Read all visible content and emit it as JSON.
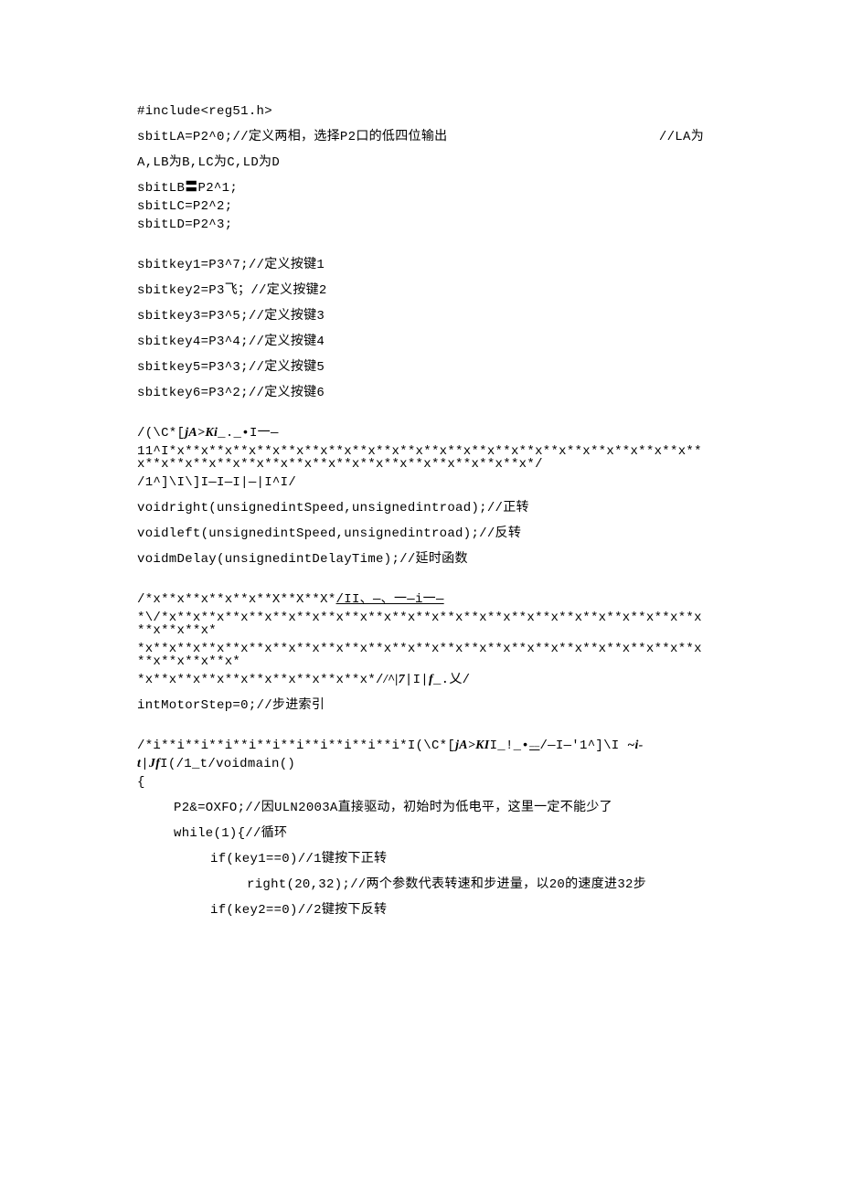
{
  "lines": {
    "l1": "#include<reg51.h>",
    "l2a": "sbitLA=P2^0;//定义两相，选择P2口的低四位输出",
    "l2b": "//LA为",
    "l3": "A,LB为B,LC为C,LD为D",
    "l4": "sbitLB〓P2^1;",
    "l5": "sbitLC=P2^2;",
    "l6": "sbitLD=P2^3;",
    "l7": "sbitkey1=P3^7;//定义按键1",
    "l8": "sbitkey2=P3飞；//定义按键2",
    "l9": "sbitkey3=P3^5;//定义按键3",
    "l10": "sbitkey4=P3^4;//定义按键4",
    "l11": "sbitkey5=P3^3;//定义按键5",
    "l12": "sbitkey6=P3^2;//定义按键6",
    "l13a": "/(\\C*[",
    "l13b": "jA>Ki",
    "l13c": "_._•I一—",
    "l14": "11^I*x**x**x**x**x**x**x**x**x**x**x**x**x**x**x**x**x**x**x**x**x**x**x**x**x**x**x**x**x**x**x**x**x**x**x**x**x**x**x*/",
    "l15": "/1^]\\I\\]I—I—I|—|I^I/",
    "l16": "voidright(unsignedintSpeed,unsignedintroad);//正转",
    "l17": "voidleft(unsignedintSpeed,unsignedintroad);//反转",
    "l18": "voidmDelay(unsignedintDelayTime);//延时函数",
    "l19a": "/*x**x**x**x**x**X**X**X*",
    "l19b": "/II、—、一—i一—",
    "l20": "*\\/*x**x**x**x**x**x**x**x**x**x**x**x**x**x**x**x**x**x**x**x**x**x**x**x**x**x*",
    "l21": "*x**x**x**x**x**x**x**x**x**x**x**x**x**x**x**x**x**x**x**x**x**x**x**x**x**x**x**x*",
    "l22a": "*x**x**x**x**x**x**x**x**x**x*/",
    "l22b": "/^|7",
    "l22c": "|I|",
    "l22d": "f",
    "l22e": "_.乂/",
    "l23": "intMotorStep=0;//步进索引",
    "l24a": "/*i**i**i**i**i**i**i**i**i**i**i*I(\\C*[",
    "l24b": "jA>KI",
    "l24c": "I_!_•",
    "l24d": "/—I—'1^]\\I ",
    "l24e": "~i-",
    "l25a": "t",
    "l25b": "|",
    "l25c": "Jf",
    "l25d": "I(/1_t/voidmain()",
    "l26": "{",
    "l27": "P2&=OXFO;//因ULN2003A直接驱动，初始时为低电平，这里一定不能少了",
    "l28": "while(1){//循环",
    "l29": "if(key1==0)//1键按下正转",
    "l30": "right(20,32);//两个参数代表转速和步进量，以20的速度进32步",
    "l31": "if(key2==0)//2键按下反转"
  }
}
